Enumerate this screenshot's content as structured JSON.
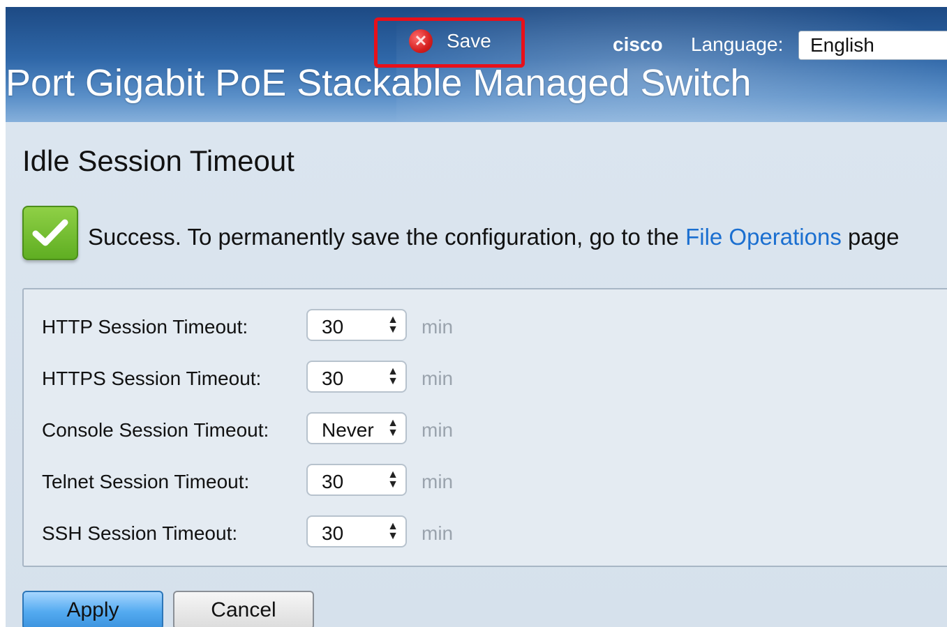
{
  "header": {
    "save_label": "Save",
    "brand": "cisco",
    "language_label": "Language:",
    "language_value": "English",
    "product_title": "Port Gigabit PoE Stackable Managed Switch"
  },
  "page": {
    "title": "Idle Session Timeout"
  },
  "notification": {
    "text_before": "Success. To permanently save the configuration, go to the ",
    "link": "File Operations",
    "text_after": " page"
  },
  "settings": [
    {
      "label": "HTTP Session Timeout:",
      "value": "30",
      "unit": "min"
    },
    {
      "label": "HTTPS Session Timeout:",
      "value": "30",
      "unit": "min"
    },
    {
      "label": "Console Session Timeout:",
      "value": "Never",
      "unit": "min"
    },
    {
      "label": "Telnet Session Timeout:",
      "value": "30",
      "unit": "min"
    },
    {
      "label": "SSH Session Timeout:",
      "value": "30",
      "unit": "min"
    }
  ],
  "buttons": {
    "apply": "Apply",
    "cancel": "Cancel"
  },
  "icons": {
    "save": "close-circle-icon",
    "success": "checkmark-icon"
  },
  "colors": {
    "highlight": "#e8101a",
    "link": "#1b6fd0",
    "success": "#5fae22",
    "apply": "#3c93de"
  }
}
